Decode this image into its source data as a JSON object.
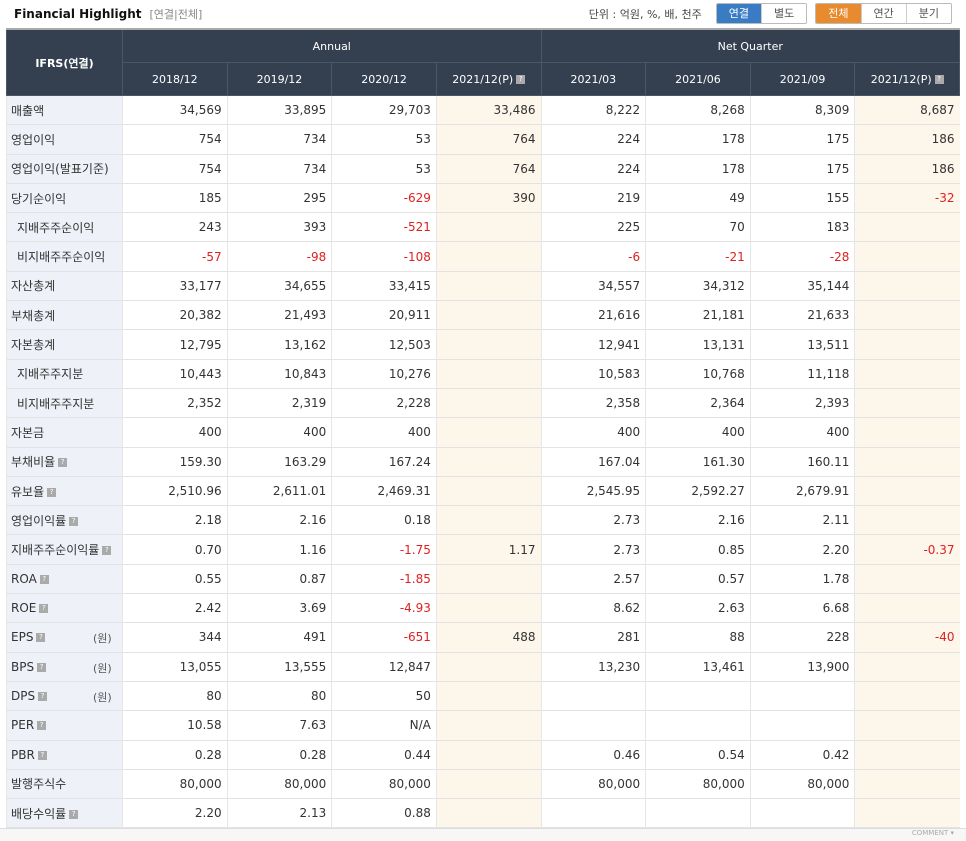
{
  "header": {
    "title": "Financial Highlight",
    "subtitle": "[연결|전체]",
    "unit": "단위 : 억원, %, 배, 천주"
  },
  "toggles": {
    "consolidation": [
      "연결",
      "별도"
    ],
    "period": [
      "전체",
      "연간",
      "분기"
    ]
  },
  "colors": {
    "blue": "#3a7cc3",
    "orange": "#e88a2e",
    "negative": "#e02020"
  },
  "table": {
    "corner": "IFRS(연결)",
    "groups": [
      "Annual",
      "Net Quarter"
    ],
    "columns": [
      "2018/12",
      "2019/12",
      "2020/12",
      "2021/12(P)",
      "2021/03",
      "2021/06",
      "2021/09",
      "2021/12(P)"
    ],
    "rows": [
      {
        "label": "매출액",
        "values": [
          "34,569",
          "33,895",
          "29,703",
          "33,486",
          "8,222",
          "8,268",
          "8,309",
          "8,687"
        ]
      },
      {
        "label": "영업이익",
        "values": [
          "754",
          "734",
          "53",
          "764",
          "224",
          "178",
          "175",
          "186"
        ]
      },
      {
        "label": "영업이익(발표기준)",
        "values": [
          "754",
          "734",
          "53",
          "764",
          "224",
          "178",
          "175",
          "186"
        ]
      },
      {
        "label": "당기순이익",
        "values": [
          "185",
          "295",
          "-629",
          "390",
          "219",
          "49",
          "155",
          "-32"
        ]
      },
      {
        "label": "지배주주순이익",
        "indent": true,
        "values": [
          "243",
          "393",
          "-521",
          "",
          "225",
          "70",
          "183",
          ""
        ]
      },
      {
        "label": "비지배주주순이익",
        "indent": true,
        "values": [
          "-57",
          "-98",
          "-108",
          "",
          "-6",
          "-21",
          "-28",
          ""
        ]
      },
      {
        "label": "자산총계",
        "values": [
          "33,177",
          "34,655",
          "33,415",
          "",
          "34,557",
          "34,312",
          "35,144",
          ""
        ]
      },
      {
        "label": "부채총계",
        "values": [
          "20,382",
          "21,493",
          "20,911",
          "",
          "21,616",
          "21,181",
          "21,633",
          ""
        ]
      },
      {
        "label": "자본총계",
        "values": [
          "12,795",
          "13,162",
          "12,503",
          "",
          "12,941",
          "13,131",
          "13,511",
          ""
        ]
      },
      {
        "label": "지배주주지분",
        "indent": true,
        "values": [
          "10,443",
          "10,843",
          "10,276",
          "",
          "10,583",
          "10,768",
          "11,118",
          ""
        ]
      },
      {
        "label": "비지배주주지분",
        "indent": true,
        "values": [
          "2,352",
          "2,319",
          "2,228",
          "",
          "2,358",
          "2,364",
          "2,393",
          ""
        ]
      },
      {
        "label": "자본금",
        "values": [
          "400",
          "400",
          "400",
          "",
          "400",
          "400",
          "400",
          ""
        ]
      },
      {
        "label": "부채비율",
        "help": true,
        "values": [
          "159.30",
          "163.29",
          "167.24",
          "",
          "167.04",
          "161.30",
          "160.11",
          ""
        ]
      },
      {
        "label": "유보율",
        "help": true,
        "values": [
          "2,510.96",
          "2,611.01",
          "2,469.31",
          "",
          "2,545.95",
          "2,592.27",
          "2,679.91",
          ""
        ]
      },
      {
        "label": "영업이익률",
        "help": true,
        "values": [
          "2.18",
          "2.16",
          "0.18",
          "",
          "2.73",
          "2.16",
          "2.11",
          ""
        ]
      },
      {
        "label": "지배주주순이익률",
        "help": true,
        "values": [
          "0.70",
          "1.16",
          "-1.75",
          "1.17",
          "2.73",
          "0.85",
          "2.20",
          "-0.37"
        ]
      },
      {
        "label": "ROA",
        "help": true,
        "values": [
          "0.55",
          "0.87",
          "-1.85",
          "",
          "2.57",
          "0.57",
          "1.78",
          ""
        ]
      },
      {
        "label": "ROE",
        "help": true,
        "values": [
          "2.42",
          "3.69",
          "-4.93",
          "",
          "8.62",
          "2.63",
          "6.68",
          ""
        ]
      },
      {
        "label": "EPS",
        "help": true,
        "unit": "(원)",
        "values": [
          "344",
          "491",
          "-651",
          "488",
          "281",
          "88",
          "228",
          "-40"
        ]
      },
      {
        "label": "BPS",
        "help": true,
        "unit": "(원)",
        "values": [
          "13,055",
          "13,555",
          "12,847",
          "",
          "13,230",
          "13,461",
          "13,900",
          ""
        ]
      },
      {
        "label": "DPS",
        "help": true,
        "unit": "(원)",
        "values": [
          "80",
          "80",
          "50",
          "",
          "",
          "",
          "",
          ""
        ]
      },
      {
        "label": "PER",
        "help": true,
        "values": [
          "10.58",
          "7.63",
          "N/A",
          "",
          "",
          "",
          "",
          ""
        ]
      },
      {
        "label": "PBR",
        "help": true,
        "values": [
          "0.28",
          "0.28",
          "0.44",
          "",
          "0.46",
          "0.54",
          "0.42",
          ""
        ]
      },
      {
        "label": "발행주식수",
        "values": [
          "80,000",
          "80,000",
          "80,000",
          "",
          "80,000",
          "80,000",
          "80,000",
          ""
        ]
      },
      {
        "label": "배당수익률",
        "help": true,
        "values": [
          "2.20",
          "2.13",
          "0.88",
          "",
          "",
          "",
          "",
          ""
        ]
      }
    ]
  },
  "footer": {
    "comment": "COMMENT"
  }
}
